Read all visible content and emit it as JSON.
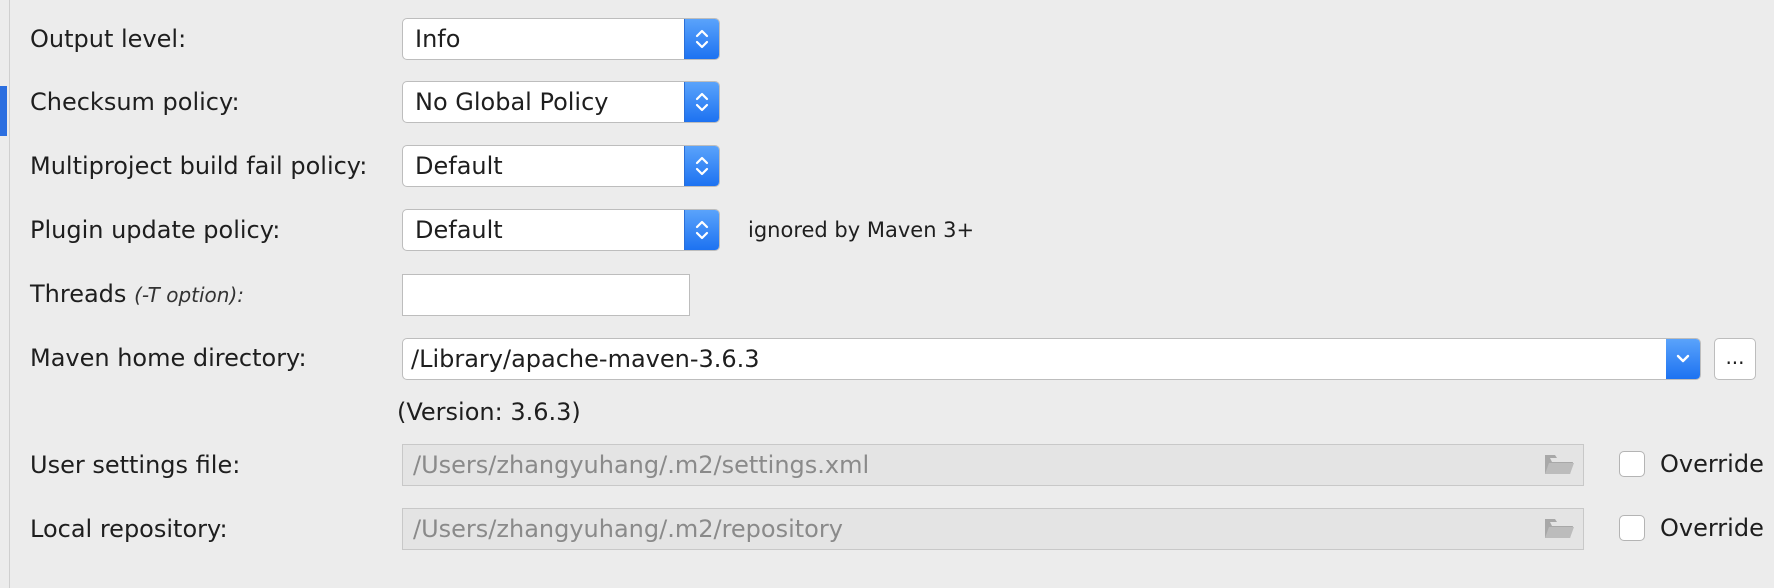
{
  "rows": {
    "output_level": {
      "label": "Output level:",
      "value": "Info"
    },
    "checksum_policy": {
      "label": "Checksum policy:",
      "value": "No Global Policy"
    },
    "fail_policy": {
      "label": "Multiproject build fail policy:",
      "value": "Default"
    },
    "plugin_update": {
      "label": "Plugin update policy:",
      "value": "Default",
      "note": "ignored by Maven 3+"
    },
    "threads": {
      "label": "Threads",
      "hint": "(-T option):",
      "value": ""
    },
    "maven_home": {
      "label": "Maven home directory:",
      "value": "/Library/apache-maven-3.6.3",
      "browse_label": "...",
      "version": "(Version: 3.6.3)"
    },
    "user_settings": {
      "label": "User settings file:",
      "value": "/Users/zhangyuhang/.m2/settings.xml",
      "override_label": "Override",
      "override_checked": false
    },
    "local_repo": {
      "label": "Local repository:",
      "value": "/Users/zhangyuhang/.m2/repository",
      "override_label": "Override",
      "override_checked": false
    }
  },
  "icons": {
    "combo_stepper": "chevron-up-down-icon",
    "dropdown": "chevron-down-icon",
    "folder": "folder-icon"
  },
  "colors": {
    "background": "#ececec",
    "accent": "#1d72f1",
    "disabled_text": "#8a8a8a"
  }
}
